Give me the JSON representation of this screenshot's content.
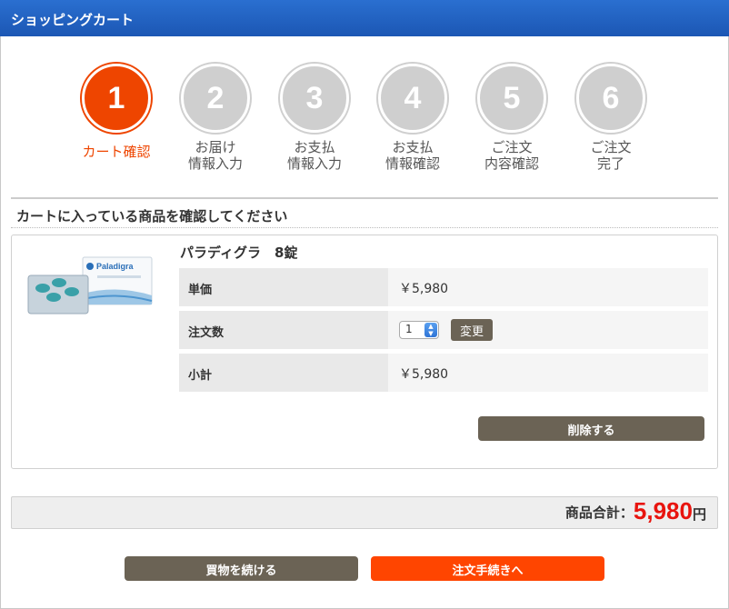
{
  "header": {
    "title": "ショッピングカート"
  },
  "steps": [
    {
      "number": "1",
      "label": "カート確認",
      "active": true
    },
    {
      "number": "2",
      "label": "お届け\n情報入力",
      "active": false
    },
    {
      "number": "3",
      "label": "お支払\n情報入力",
      "active": false
    },
    {
      "number": "4",
      "label": "お支払\n情報確認",
      "active": false
    },
    {
      "number": "5",
      "label": "ご注文\n内容確認",
      "active": false
    },
    {
      "number": "6",
      "label": "ご注文\n完了",
      "active": false
    }
  ],
  "section_title": "カートに入っている商品を確認してください",
  "item": {
    "name": "パラディグラ　8錠",
    "image_brand": "Paladigra",
    "rows": {
      "unit_price_label": "単価",
      "unit_price_value": "￥5,980",
      "quantity_label": "注文数",
      "quantity_value": "1",
      "change_label": "変更",
      "subtotal_label": "小計",
      "subtotal_value": "￥5,980"
    },
    "delete_label": "削除する"
  },
  "total": {
    "label": "商品合計：",
    "amount": "5,980",
    "currency": "円"
  },
  "buttons": {
    "continue": "買物を続ける",
    "checkout": "注文手続きへ"
  },
  "colors": {
    "accent": "#ff4500",
    "header": "#1f5fbf",
    "button": "#6b6355",
    "price": "#e8140e"
  }
}
